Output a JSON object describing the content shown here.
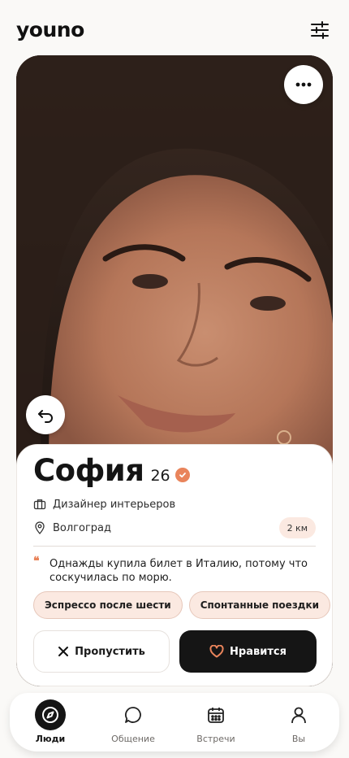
{
  "app": {
    "logo": "youno"
  },
  "header": {
    "filter_icon": "sliders-icon"
  },
  "profile": {
    "name": "София",
    "age": "26",
    "verified": true,
    "job": "Дизайнер интерьеров",
    "city": "Волгоград",
    "distance": "2 км",
    "bio": "Однажды купила билет в Италию, потому что соскучилась по морю.",
    "quote_mark": "❝",
    "tags": [
      "Эспрессо после шести",
      "Спонтанные поездки"
    ]
  },
  "actions": {
    "skip_label": "Пропустить",
    "like_label": "Нравится"
  },
  "tabs": [
    {
      "label": "Люди",
      "icon": "compass-icon",
      "active": true
    },
    {
      "label": "Общение",
      "icon": "chat-bubble-icon",
      "active": false
    },
    {
      "label": "Встречи",
      "icon": "calendar-icon",
      "active": false
    },
    {
      "label": "Вы",
      "icon": "user-icon",
      "active": false
    }
  ],
  "colors": {
    "accent": "#e9845b",
    "accent_soft": "#fbe9e1",
    "dark": "#151515",
    "background": "#faf9f7"
  }
}
